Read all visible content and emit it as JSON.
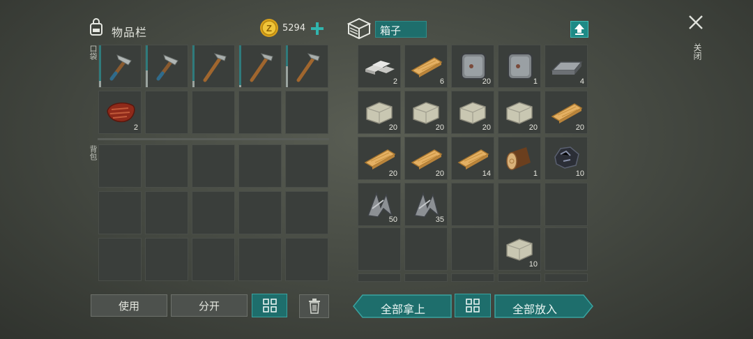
{
  "inventory": {
    "title": "物品栏",
    "coins": "5294",
    "pocket_label": "口袋",
    "backpack_label": "背包",
    "pocket": [
      {
        "icon": "hammer-icon",
        "qty": "",
        "durability": 0.15
      },
      {
        "icon": "hammer-icon",
        "qty": "",
        "durability": 0.4
      },
      {
        "icon": "pickaxe-icon",
        "qty": "",
        "durability": 0.15
      },
      {
        "icon": "pickaxe-icon",
        "qty": "",
        "durability": 0.05
      },
      {
        "icon": "pickaxe-icon",
        "qty": "",
        "durability": 0.5
      },
      {
        "icon": "meat-icon",
        "qty": "2"
      },
      {
        "icon": "",
        "qty": ""
      },
      {
        "icon": "",
        "qty": ""
      },
      {
        "icon": "",
        "qty": ""
      },
      {
        "icon": "",
        "qty": ""
      }
    ]
  },
  "box": {
    "title": "箱子",
    "items": [
      {
        "icon": "metal-ingot-icon",
        "qty": "2"
      },
      {
        "icon": "wood-plank-icon",
        "qty": "6"
      },
      {
        "icon": "iron-plate-icon",
        "qty": "20"
      },
      {
        "icon": "iron-plate-icon",
        "qty": "1"
      },
      {
        "icon": "iron-bar-icon",
        "qty": "4"
      },
      {
        "icon": "stone-block-icon",
        "qty": "20"
      },
      {
        "icon": "stone-block-icon",
        "qty": "20"
      },
      {
        "icon": "stone-block-icon",
        "qty": "20"
      },
      {
        "icon": "stone-block-icon",
        "qty": "20"
      },
      {
        "icon": "wood-plank-icon",
        "qty": "20"
      },
      {
        "icon": "wood-plank-icon",
        "qty": "20"
      },
      {
        "icon": "wood-plank-icon",
        "qty": "20"
      },
      {
        "icon": "wood-plank-icon",
        "qty": "14"
      },
      {
        "icon": "log-icon",
        "qty": "1"
      },
      {
        "icon": "ore-icon",
        "qty": "10"
      },
      {
        "icon": "metal-scrap-icon",
        "qty": "50"
      },
      {
        "icon": "metal-scrap-icon",
        "qty": "35"
      },
      {
        "icon": "",
        "qty": ""
      },
      {
        "icon": "",
        "qty": ""
      },
      {
        "icon": "",
        "qty": ""
      },
      {
        "icon": "",
        "qty": ""
      },
      {
        "icon": "",
        "qty": ""
      },
      {
        "icon": "",
        "qty": ""
      },
      {
        "icon": "stone-block-icon",
        "qty": "10"
      },
      {
        "icon": "",
        "qty": ""
      }
    ]
  },
  "buttons": {
    "use": "使用",
    "split": "分开",
    "take_all": "全部拿上",
    "put_all": "全部放入"
  },
  "close_label": "关闭",
  "colors": {
    "accent_teal": "#1e6e6c",
    "coin_gold": "#d9a21b"
  }
}
